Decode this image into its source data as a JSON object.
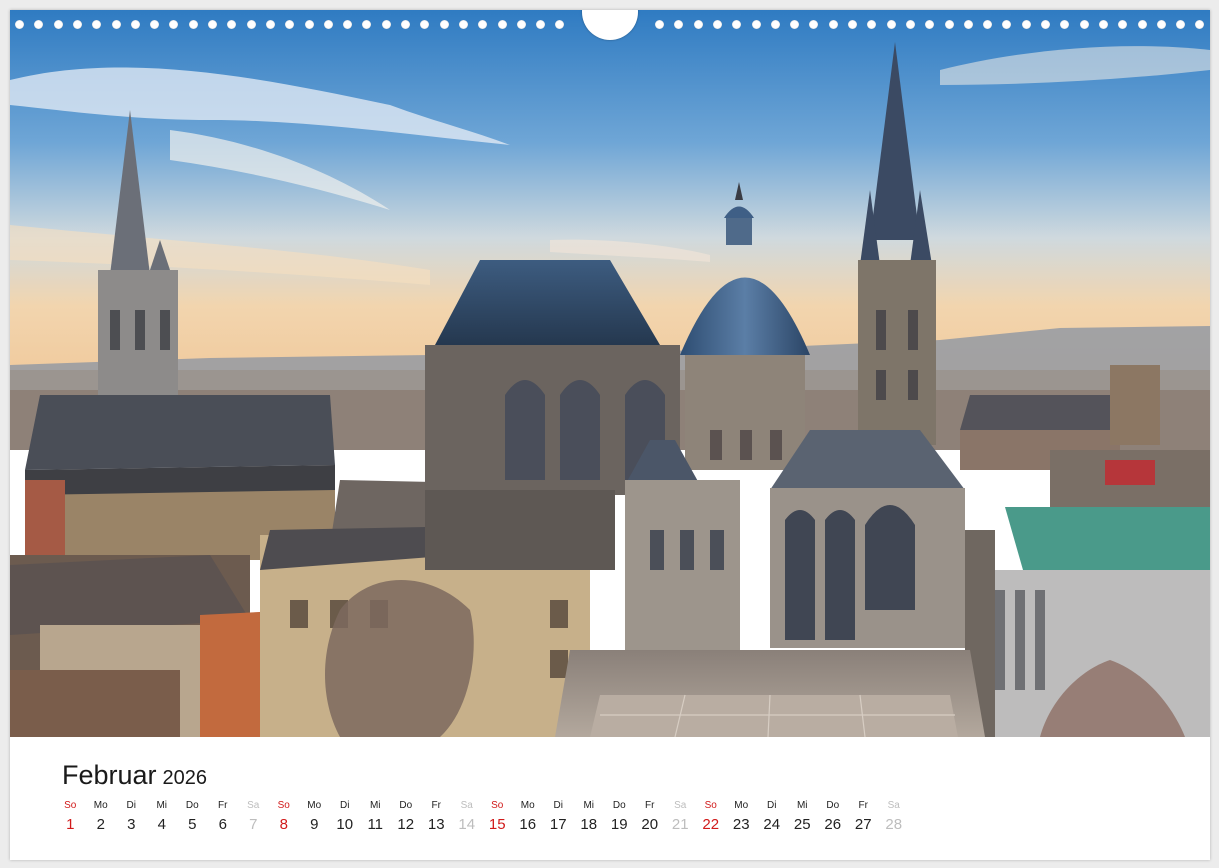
{
  "calendar": {
    "month": "Februar",
    "year": "2026",
    "days": [
      {
        "dow": "So",
        "num": "1",
        "type": "sun"
      },
      {
        "dow": "Mo",
        "num": "2",
        "type": "wd"
      },
      {
        "dow": "Di",
        "num": "3",
        "type": "wd"
      },
      {
        "dow": "Mi",
        "num": "4",
        "type": "wd"
      },
      {
        "dow": "Do",
        "num": "5",
        "type": "wd"
      },
      {
        "dow": "Fr",
        "num": "6",
        "type": "wd"
      },
      {
        "dow": "Sa",
        "num": "7",
        "type": "sat"
      },
      {
        "dow": "So",
        "num": "8",
        "type": "sun"
      },
      {
        "dow": "Mo",
        "num": "9",
        "type": "wd"
      },
      {
        "dow": "Di",
        "num": "10",
        "type": "wd"
      },
      {
        "dow": "Mi",
        "num": "11",
        "type": "wd"
      },
      {
        "dow": "Do",
        "num": "12",
        "type": "wd"
      },
      {
        "dow": "Fr",
        "num": "13",
        "type": "wd"
      },
      {
        "dow": "Sa",
        "num": "14",
        "type": "sat"
      },
      {
        "dow": "So",
        "num": "15",
        "type": "sun"
      },
      {
        "dow": "Mo",
        "num": "16",
        "type": "wd"
      },
      {
        "dow": "Di",
        "num": "17",
        "type": "wd"
      },
      {
        "dow": "Mi",
        "num": "18",
        "type": "wd"
      },
      {
        "dow": "Do",
        "num": "19",
        "type": "wd"
      },
      {
        "dow": "Fr",
        "num": "20",
        "type": "wd"
      },
      {
        "dow": "Sa",
        "num": "21",
        "type": "sat"
      },
      {
        "dow": "So",
        "num": "22",
        "type": "sun"
      },
      {
        "dow": "Mo",
        "num": "23",
        "type": "wd"
      },
      {
        "dow": "Di",
        "num": "24",
        "type": "wd"
      },
      {
        "dow": "Mi",
        "num": "25",
        "type": "wd"
      },
      {
        "dow": "Do",
        "num": "26",
        "type": "wd"
      },
      {
        "dow": "Fr",
        "num": "27",
        "type": "wd"
      },
      {
        "dow": "Sa",
        "num": "28",
        "type": "sat"
      }
    ]
  },
  "colors": {
    "sunday": "#d11a1a",
    "saturday": "#bdbdbd",
    "weekday": "#222222"
  }
}
